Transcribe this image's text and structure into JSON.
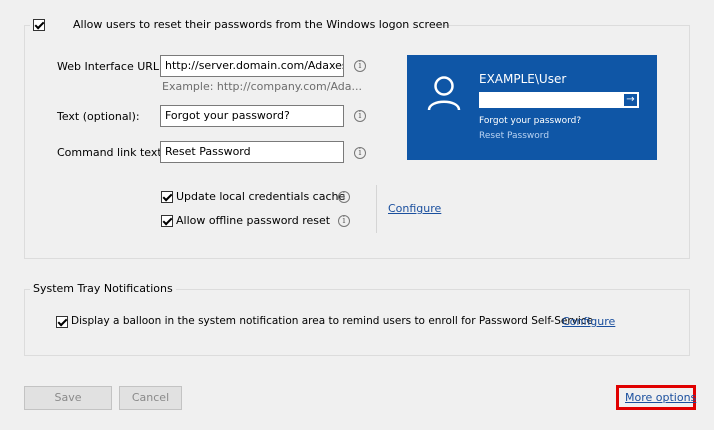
{
  "logon_reset": {
    "checkbox_label": "Allow users to reset their passwords from the Windows logon screen",
    "checked": true,
    "web_url_label": "Web Interface URL:",
    "web_url_value": "http://server.domain.com/Adaxes/Se",
    "web_url_example": "Example: http://company.com/Ada...",
    "text_label": "Text (optional):",
    "text_value": "Forgot your password?",
    "command_label": "Command link text:",
    "command_value": "Reset Password",
    "update_cache_label": "Update local credentials cache",
    "offline_reset_label": "Allow offline password reset",
    "configure_link": "Configure"
  },
  "preview": {
    "username": "EXAMPLE\\User",
    "forgot_text": "Forgot your password?",
    "reset_link": "Reset Password",
    "bg_color": "#0f56a6"
  },
  "tray": {
    "group_label": "System Tray Notifications",
    "balloon_label": "Display a balloon in the system notification area to remind users to enroll for Password Self-Service",
    "configure_link": "Configure"
  },
  "footer": {
    "save_label": "Save",
    "cancel_label": "Cancel",
    "more_options_label": "More options",
    "highlight_color": "#e00000"
  }
}
